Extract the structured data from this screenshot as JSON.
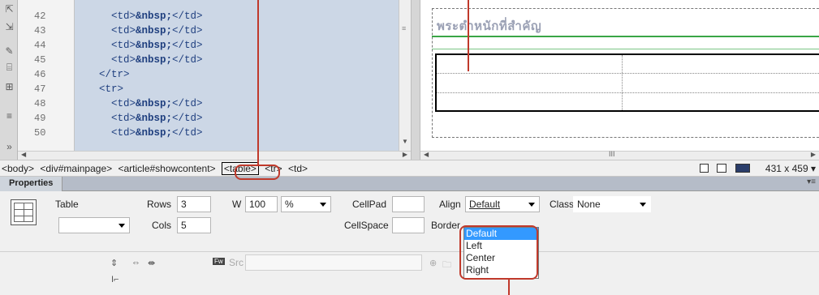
{
  "code": {
    "line_numbers": [
      "42",
      "43",
      "44",
      "45",
      "46",
      "47",
      "48",
      "49",
      "50"
    ],
    "lines": [
      {
        "indent": "      ",
        "pre": "<td>",
        "bold": "&nbsp;",
        "post": "</td>"
      },
      {
        "indent": "      ",
        "pre": "<td>",
        "bold": "&nbsp;",
        "post": "</td>"
      },
      {
        "indent": "      ",
        "pre": "<td>",
        "bold": "&nbsp;",
        "post": "</td>"
      },
      {
        "indent": "      ",
        "pre": "<td>",
        "bold": "&nbsp;",
        "post": "</td>"
      },
      {
        "indent": "    ",
        "pre": "</tr>",
        "bold": "",
        "post": ""
      },
      {
        "indent": "    ",
        "pre": "<tr>",
        "bold": "",
        "post": ""
      },
      {
        "indent": "      ",
        "pre": "<td>",
        "bold": "&nbsp;",
        "post": "</td>"
      },
      {
        "indent": "      ",
        "pre": "<td>",
        "bold": "&nbsp;",
        "post": "</td>"
      },
      {
        "indent": "      ",
        "pre": "<td>",
        "bold": "&nbsp;",
        "post": "</td>"
      }
    ]
  },
  "design_view": {
    "heading": "พระตำหนักที่สำคัญ",
    "hscroll_grip": "III"
  },
  "tag_selector": {
    "tags": [
      "<body>",
      "<div#mainpage>",
      "<article#showcontent>",
      "<table>",
      "<tr>",
      "<td>"
    ],
    "selected_index": 3,
    "window_size": "431 x 459"
  },
  "properties": {
    "panel_title": "Properties",
    "element_type": "Table",
    "rows_label": "Rows",
    "rows_value": "3",
    "cols_label": "Cols",
    "cols_value": "5",
    "w_label": "W",
    "w_value": "100",
    "w_unit": "%",
    "cellpad_label": "CellPad",
    "cellpad_value": "",
    "cellspace_label": "CellSpace",
    "cellspace_value": "",
    "align_label": "Align",
    "align_value": "Default",
    "align_options": [
      "Default",
      "Left",
      "Center",
      "Right"
    ],
    "border_label": "Border",
    "class_label": "Class",
    "class_value": "None",
    "src_label": "Src",
    "id_value": ""
  },
  "colors": {
    "code_bg": "#ccd7e6",
    "highlight": "#c0392b",
    "selection": "#3399ff"
  }
}
